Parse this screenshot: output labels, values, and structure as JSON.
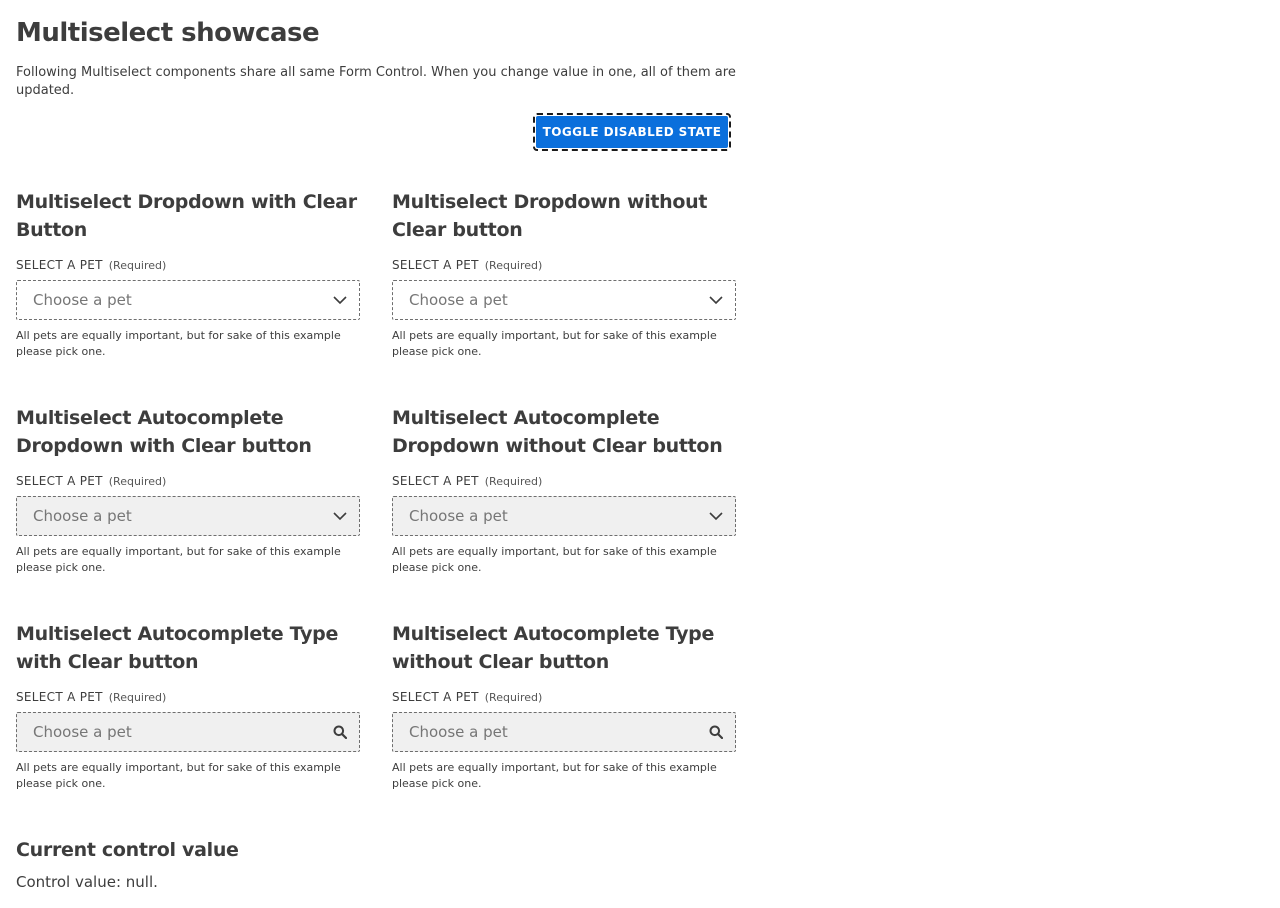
{
  "page": {
    "title": "Multiselect showcase",
    "intro": "Following Multiselect components share all same Form Control. When you change value in one, all of them are updated.",
    "toggle_label": "TOGGLE DISABLED STATE"
  },
  "fields": [
    {
      "title": "Multiselect Dropdown with Clear Button",
      "label": "SELECT A PET",
      "required": "(Required)",
      "placeholder": "Choose a pet",
      "help": "All pets are equally important, but for sake of this example please pick one.",
      "icon": "chevron-down-icon"
    },
    {
      "title": "Multiselect Dropdown without Clear button",
      "label": "SELECT A PET",
      "required": "(Required)",
      "placeholder": "Choose a pet",
      "help": "All pets are equally important, but for sake of this example please pick one.",
      "icon": "chevron-down-icon"
    },
    {
      "title": "Multiselect Autocomplete Dropdown with Clear button",
      "label": "SELECT A PET",
      "required": "(Required)",
      "placeholder": "Choose a pet",
      "help": "All pets are equally important, but for sake of this example please pick one.",
      "icon": "chevron-down-icon"
    },
    {
      "title": "Multiselect Autocomplete Dropdown without Clear button",
      "label": "SELECT A PET",
      "required": "(Required)",
      "placeholder": "Choose a pet",
      "help": "All pets are equally important, but for sake of this example please pick one.",
      "icon": "chevron-down-icon"
    },
    {
      "title": "Multiselect Autocomplete Type with Clear button",
      "label": "SELECT A PET",
      "required": "(Required)",
      "placeholder": "Choose a pet",
      "help": "All pets are equally important, but for sake of this example please pick one.",
      "icon": "search-icon"
    },
    {
      "title": "Multiselect Autocomplete Type without Clear button",
      "label": "SELECT A PET",
      "required": "(Required)",
      "placeholder": "Choose a pet",
      "help": "All pets are equally important, but for sake of this example please pick one.",
      "icon": "search-icon"
    }
  ],
  "current": {
    "title": "Current control value",
    "value_text": "Control value: null."
  },
  "colors": {
    "primary_button": "#0a6fdc",
    "text": "#3d3d3d",
    "shaded_input": "#f0f0f0"
  }
}
